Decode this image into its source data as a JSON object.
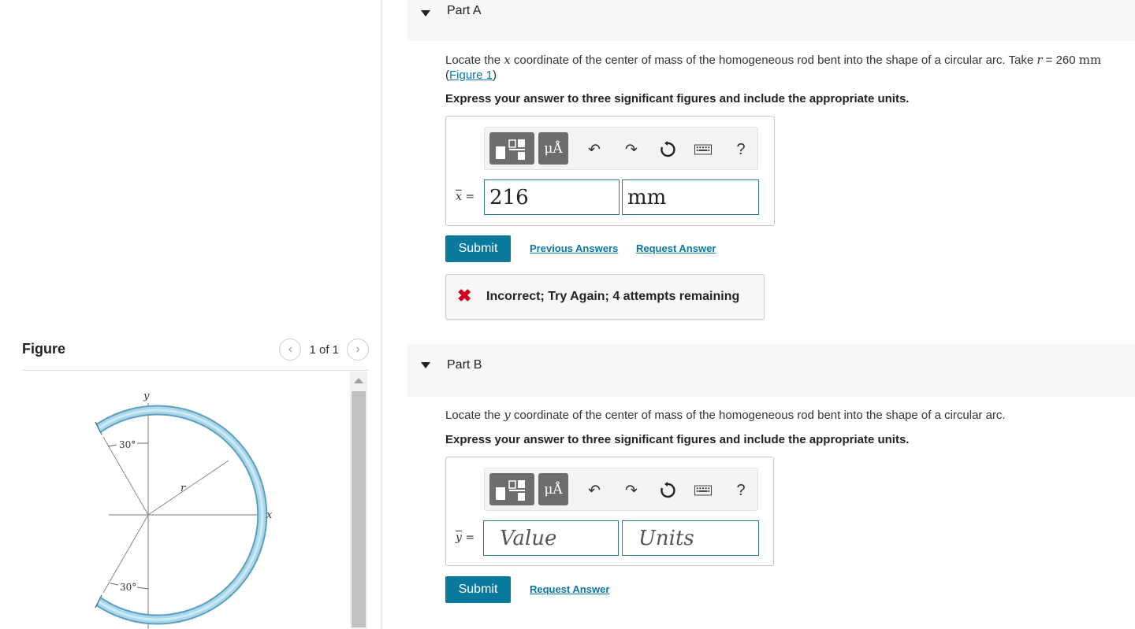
{
  "figure_panel": {
    "title": "Figure",
    "pager_text": "1 of 1",
    "labels": {
      "y_axis": "y",
      "x_axis": "x",
      "radius": "r",
      "angle_top": "30°",
      "angle_bottom": "30°"
    }
  },
  "part_a": {
    "title": "Part A",
    "prompt_start": "Locate the ",
    "prompt_var": "x",
    "prompt_mid": " coordinate of the center of mass of the homogeneous rod bent into the shape of a circular arc. Take ",
    "prompt_r": "r",
    "prompt_eq": " = 260 ",
    "prompt_unit": "mm",
    "figure_link": "Figure 1",
    "instruction": "Express your answer to three significant figures and include the appropriate units.",
    "units_button": "μÅ",
    "help_label": "?",
    "variable": "x",
    "equals": " =",
    "value": "216",
    "unit": "mm",
    "submit_label": "Submit",
    "previous_answers_label": "Previous Answers",
    "request_answer_label": "Request Answer",
    "feedback_text": "Incorrect; Try Again; 4 attempts remaining"
  },
  "part_b": {
    "title": "Part B",
    "prompt_start": "Locate the ",
    "prompt_var": "y",
    "prompt_end": " coordinate of the center of mass of the homogeneous rod bent into the shape of a circular arc.",
    "instruction": "Express your answer to three significant figures and include the appropriate units.",
    "units_button": "μÅ",
    "help_label": "?",
    "variable": "y",
    "equals": " =",
    "value_placeholder": "Value",
    "unit_placeholder": "Units",
    "submit_label": "Submit",
    "request_answer_label": "Request Answer"
  },
  "colors": {
    "accent": "#0a7a9c",
    "link": "#0a77a6",
    "error": "#d0021b",
    "rod_fill": "#9fd0e6"
  }
}
